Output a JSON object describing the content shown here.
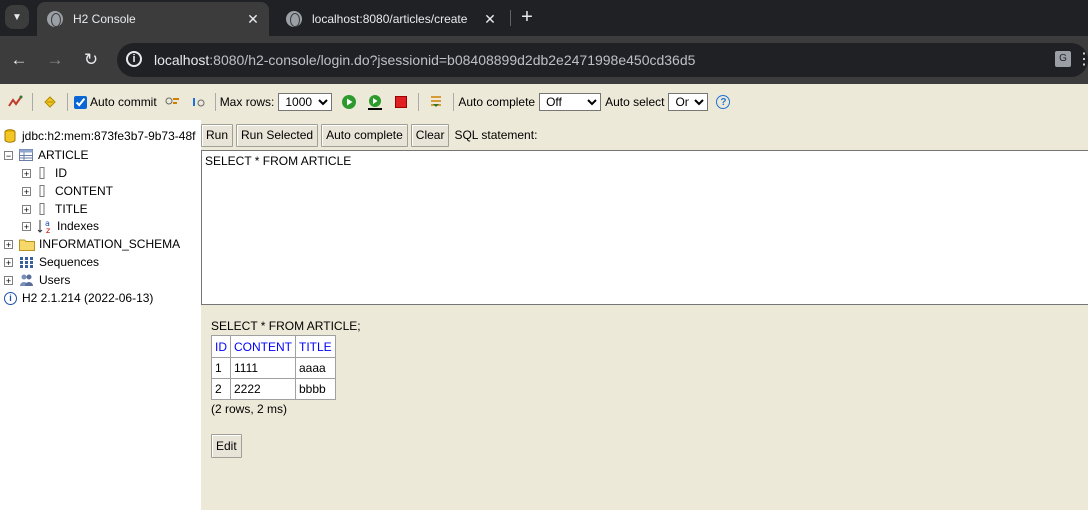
{
  "browser": {
    "tabs": [
      {
        "title": "H2 Console",
        "active": true
      },
      {
        "title": "localhost:8080/articles/create",
        "active": false
      }
    ],
    "url_host": "localhost",
    "url_rest": ":8080/h2-console/login.do?jsessionid=b08408899d2db2e2471998e450cd36d5"
  },
  "toolbar": {
    "auto_commit_label": "Auto commit",
    "auto_commit_checked": true,
    "max_rows_label": "Max rows:",
    "max_rows_value": "1000",
    "auto_complete_label": "Auto complete",
    "auto_complete_value": "Off",
    "auto_select_label": "Auto select",
    "auto_select_value": "On",
    "help_glyph": "?"
  },
  "tree": {
    "connection": "jdbc:h2:mem:873fe3b7-9b73-48f",
    "table": "ARTICLE",
    "columns": [
      "ID",
      "CONTENT",
      "TITLE"
    ],
    "indexes": "Indexes",
    "schema": "INFORMATION_SCHEMA",
    "sequences": "Sequences",
    "users": "Users",
    "version": "H2 2.1.214 (2022-06-13)"
  },
  "query": {
    "buttons": {
      "run": "Run",
      "run_selected": "Run Selected",
      "auto_complete": "Auto complete",
      "clear": "Clear"
    },
    "sql_label": "SQL statement:",
    "sql_text": "SELECT * FROM ARTICLE"
  },
  "result": {
    "statement": "SELECT * FROM ARTICLE;",
    "headers": [
      "ID",
      "CONTENT",
      "TITLE"
    ],
    "rows": [
      [
        "1",
        "1111",
        "aaaa"
      ],
      [
        "2",
        "2222",
        "bbbb"
      ]
    ],
    "info": "(2 rows, 2 ms)",
    "edit_label": "Edit"
  }
}
